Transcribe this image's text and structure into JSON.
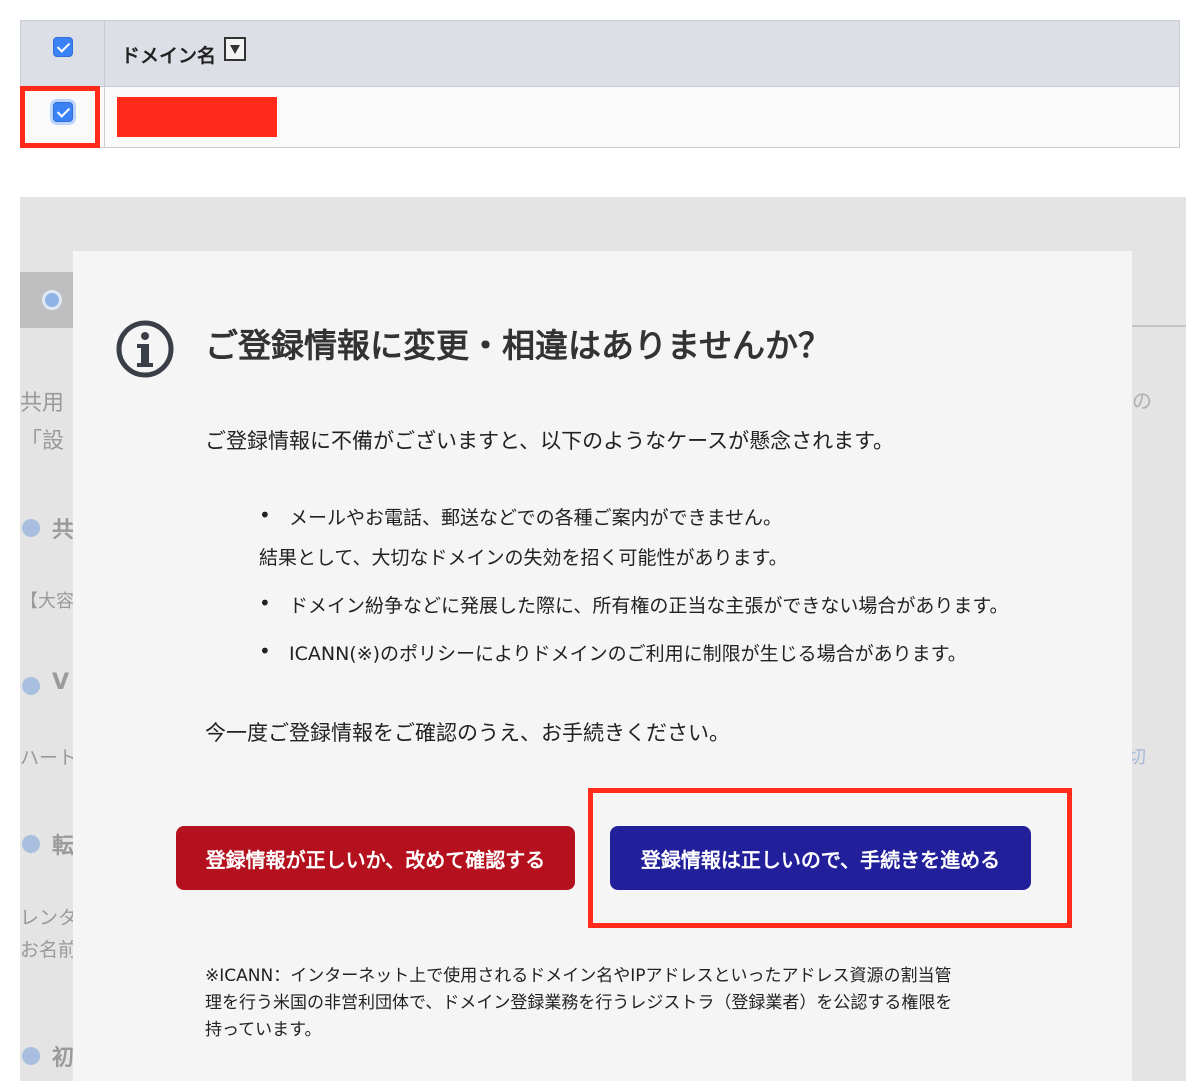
{
  "domain_table": {
    "header_label": "ドメイン名",
    "header_checked": true,
    "row_checked": true
  },
  "background_page": {
    "lines": [
      "共用",
      "「設",
      "共",
      "【大容",
      "V",
      "ハート",
      "転",
      "レンタ",
      "お名前",
      "初"
    ],
    "right_fragments": [
      "の",
      "切"
    ]
  },
  "modal": {
    "title": "ご登録情報に変更・相違はありませんか？",
    "intro": "ご登録情報に不備がございますと、以下のようなケースが懸念されます。",
    "bullets": [
      "メールやお電話、郵送などでの各種ご案内ができません。",
      "ドメイン紛争などに発展した際に、所有権の正当な主張ができない場合があります。",
      "ICANN(※)のポリシーによりドメインのご利用に制限が生じる場合があります。"
    ],
    "bullet1_continuation": "結果として、大切なドメインの失効を招く可能性があります。",
    "confirm": "今一度ご登録情報をご確認のうえ、お手続きください。",
    "buttons": {
      "recheck": "登録情報が正しいか、改めて確認する",
      "proceed": "登録情報は正しいので、手続きを進める"
    },
    "footnote_lines": [
      "※ICANN：インターネット上で使用されるドメイン名やIPアドレスといったアドレス資源の割当管",
      "理を行う米国の非営利団体で、ドメイン登録業務を行うレジストラ（登録業者）を公認する権限を",
      "持っています。"
    ]
  },
  "colors": {
    "highlight": "#ff2a1a",
    "recheck_button": "#b5101e",
    "proceed_button": "#221f9a",
    "checkbox": "#3b82f6"
  },
  "icons": [
    "info-icon",
    "sort-icon",
    "checkbox-checked-icon"
  ]
}
